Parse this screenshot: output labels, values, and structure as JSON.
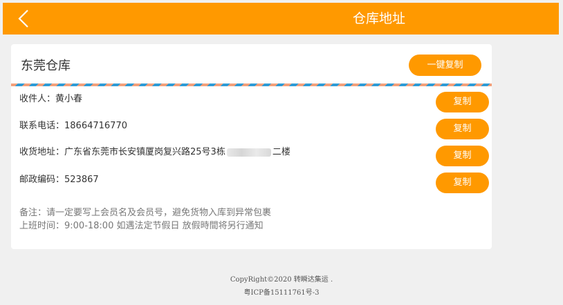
{
  "header": {
    "title": "仓库地址",
    "back_icon": "chevron-left-icon"
  },
  "warehouse": {
    "name": "东莞仓库",
    "copy_all_label": "一键复制"
  },
  "fields": [
    {
      "label": "收件人：",
      "value": "黄小春",
      "copy_label": "复制"
    },
    {
      "label": "联系电话：",
      "value": "18664716770",
      "copy_label": "复制"
    },
    {
      "label": "收货地址：",
      "value": "广东省东莞市长安镇厦岗复兴路25号3栋",
      "value_suffix": "二楼",
      "copy_label": "复制"
    },
    {
      "label": "邮政编码：",
      "value": "523867",
      "copy_label": "复制"
    }
  ],
  "notes": {
    "line1": "备注：请一定要写上会员名及会员号，避免货物入库到异常包裹",
    "line2": "上班时间：9:00-18:00 如遇法定节假日 放假時間将另行通知"
  },
  "footer": {
    "copyright": "CopyRight©2020 转瞬达集运 .",
    "icp": "粤ICP备15111761号-3"
  },
  "colors": {
    "accent": "#ff9900",
    "background": "#f0f0f0",
    "stripe_a": "#f4a07a",
    "stripe_b": "#2d9bd6"
  }
}
